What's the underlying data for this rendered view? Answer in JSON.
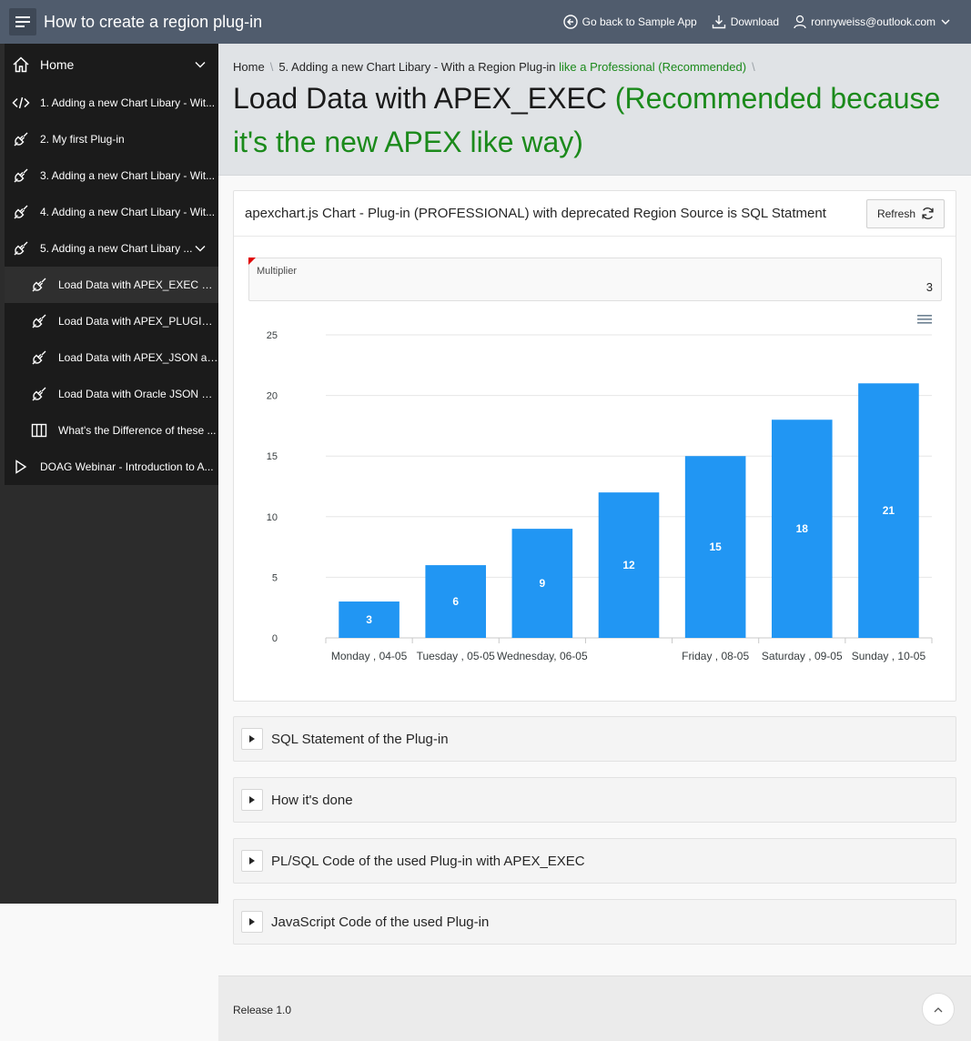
{
  "header": {
    "title": "How to create a region plug-in",
    "nav": [
      {
        "label": "Go back to Sample App",
        "icon": "arrow-circle-left-icon"
      },
      {
        "label": "Download",
        "icon": "download-icon"
      },
      {
        "label": "ronnyweiss@outlook.com",
        "icon": "user-icon"
      }
    ]
  },
  "sidebar": {
    "items": [
      {
        "label": "Home",
        "icon": "home-icon"
      },
      {
        "label": "1. Adding a new Chart Libary - Wit...",
        "icon": "code-icon"
      },
      {
        "label": "2. My first Plug-in",
        "icon": "plug-icon"
      },
      {
        "label": "3. Adding a new Chart Libary - Wit...",
        "icon": "plug-icon"
      },
      {
        "label": "4. Adding a new Chart Libary - Wit...",
        "icon": "plug-icon"
      },
      {
        "label": "5. Adding a new Chart Libary ...",
        "icon": "plug-icon"
      },
      {
        "label": "Load Data with APEX_EXEC <s...",
        "icon": "plug-icon"
      },
      {
        "label": "Load Data with APEX_PLUGIN_...",
        "icon": "plug-icon"
      },
      {
        "label": "Load Data with APEX_JSON an...",
        "icon": "plug-icon"
      },
      {
        "label": "Load Data with Oracle JSON an...",
        "icon": "plug-icon"
      },
      {
        "label": "What's the Difference of these ...",
        "icon": "columns-icon"
      },
      {
        "label": "DOAG Webinar - Introduction to A...",
        "icon": "play-icon"
      }
    ]
  },
  "breadcrumb": {
    "home": "Home",
    "current_main": "5. Adding a new Chart Libary - With a Region Plug-in",
    "current_green": "like a Professional (Recommended)",
    "sep": "\\"
  },
  "page": {
    "title_main": "Load Data with APEX_EXEC",
    "title_green": "(Recommended because it's the new APEX like way)"
  },
  "region": {
    "title": "apexchart.js Chart - Plug-in (PROFESSIONAL) with deprecated Region Source is SQL Statment",
    "refresh_label": "Refresh",
    "multiplier_label": "Multiplier",
    "multiplier_value": "3"
  },
  "chart_data": {
    "type": "bar",
    "categories": [
      "Monday , 04-05",
      "Tuesday , 05-05",
      "Wednesday, 06-05",
      "",
      "Friday , 08-05",
      "Saturday , 09-05",
      "Sunday , 10-05"
    ],
    "values": [
      3,
      6,
      9,
      12,
      15,
      18,
      21
    ],
    "ylim": [
      0,
      25
    ],
    "yticks": [
      0,
      5,
      10,
      15,
      20,
      25
    ],
    "bar_color": "#2196f3",
    "grid": true
  },
  "collapsibles": [
    {
      "title": "SQL Statement of the Plug-in"
    },
    {
      "title": "How it's done"
    },
    {
      "title": "PL/SQL Code of the used Plug-in with APEX_EXEC"
    },
    {
      "title": "JavaScript Code of the used Plug-in"
    }
  ],
  "footer": {
    "release": "Release 1.0"
  }
}
